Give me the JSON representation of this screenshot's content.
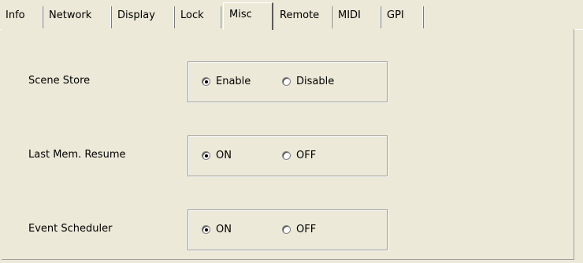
{
  "tabs": [
    {
      "label": "Info"
    },
    {
      "label": "Network"
    },
    {
      "label": "Display"
    },
    {
      "label": "Lock"
    },
    {
      "label": "Misc",
      "active": true
    },
    {
      "label": "Remote"
    },
    {
      "label": "MIDI"
    },
    {
      "label": "GPI"
    }
  ],
  "settings": {
    "scene_store": {
      "label": "Scene Store",
      "options": [
        "Enable",
        "Disable"
      ],
      "selected": "Enable"
    },
    "last_mem_resume": {
      "label": "Last Mem. Resume",
      "options": [
        "ON",
        "OFF"
      ],
      "selected": "ON"
    },
    "event_scheduler": {
      "label": "Event Scheduler",
      "options": [
        "ON",
        "OFF"
      ],
      "selected": "ON"
    }
  }
}
